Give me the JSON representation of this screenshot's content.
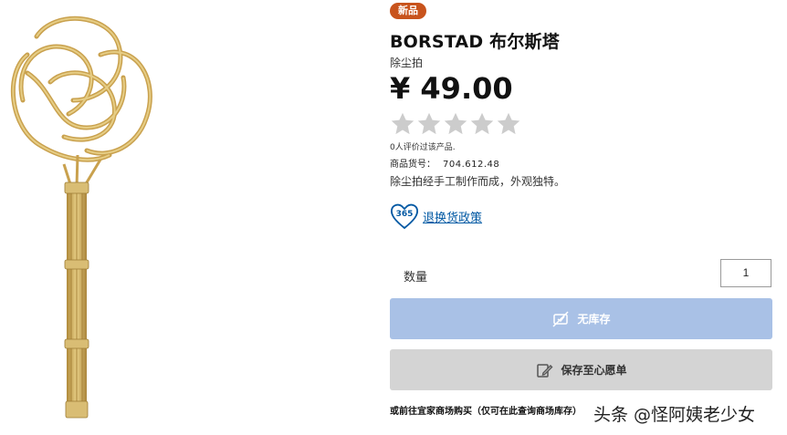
{
  "product": {
    "badge": "新品",
    "title": "BORSTAD 布尔斯塔",
    "subtitle": "除尘拍",
    "price": "¥ 49.00",
    "rating": 0,
    "rating_max": 5,
    "reviews_text": "0人评价过该产品.",
    "article_label": "商品货号：",
    "article_number": "704.612.48",
    "description": "除尘拍经手工制作而成，外观独特。"
  },
  "policy": {
    "icon_text": "365",
    "link": "退换货政策"
  },
  "quantity": {
    "label": "数量",
    "value": "1"
  },
  "buttons": {
    "out_of_stock": "无库存",
    "wishlist": "保存至心愿单"
  },
  "store_note": "或前往宜家商场购买（仅可在此查询商场库存）",
  "watermark": "头条 @怪阿姨老少女",
  "colors": {
    "badge": "#c8531c",
    "stock_button": "#a9c1e6",
    "wishlist_button": "#d4d4d4",
    "link": "#0058a3",
    "star_empty": "#cccccc"
  }
}
